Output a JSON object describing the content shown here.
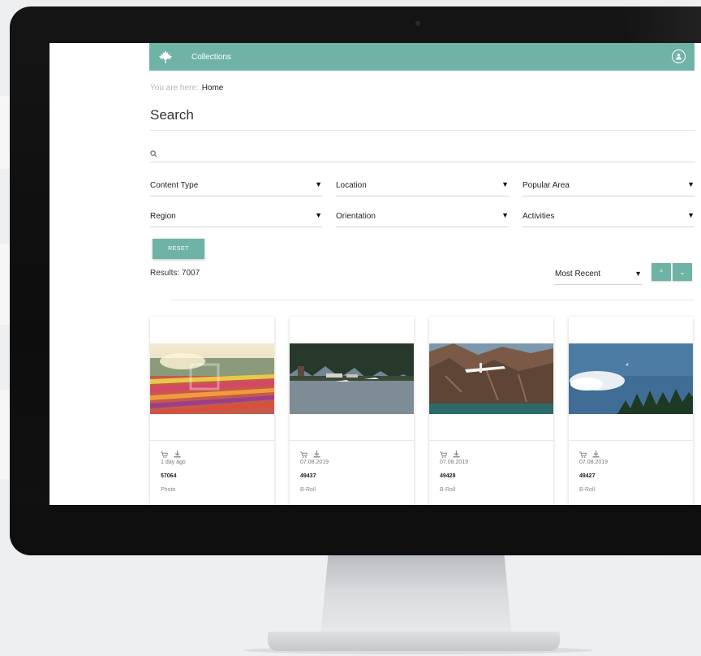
{
  "app": {
    "title": "Collections"
  },
  "breadcrumb": {
    "prefix": "You are here:",
    "current": "Home"
  },
  "page": {
    "title": "Search"
  },
  "search": {
    "placeholder": ""
  },
  "filters": [
    {
      "label": "Content Type"
    },
    {
      "label": "Location"
    },
    {
      "label": "Popular Area"
    },
    {
      "label": "Region"
    },
    {
      "label": "Orientation"
    },
    {
      "label": "Activities"
    }
  ],
  "reset": {
    "label": "RESET"
  },
  "results": {
    "label": "Results: 7007"
  },
  "sort": {
    "selected": "Most Recent",
    "asc_icon": "chevron-up-icon",
    "desc_icon": "chevron-down-icon"
  },
  "cards": [
    {
      "date": "1 day ago",
      "id": "57064",
      "type": "Photo",
      "image": "tulip-fields"
    },
    {
      "date": "07.08.2019",
      "id": "49437",
      "type": "B-Roll",
      "image": "floatplane-dock"
    },
    {
      "date": "07.08.2019",
      "id": "49428",
      "type": "B-Roll",
      "image": "floatplane-mountains"
    },
    {
      "date": "07.08.2019",
      "id": "49427",
      "type": "B-Roll",
      "image": "aerial-forest-clouds"
    }
  ],
  "colors": {
    "accent": "#6fb3a6",
    "bezel": "#111111"
  }
}
